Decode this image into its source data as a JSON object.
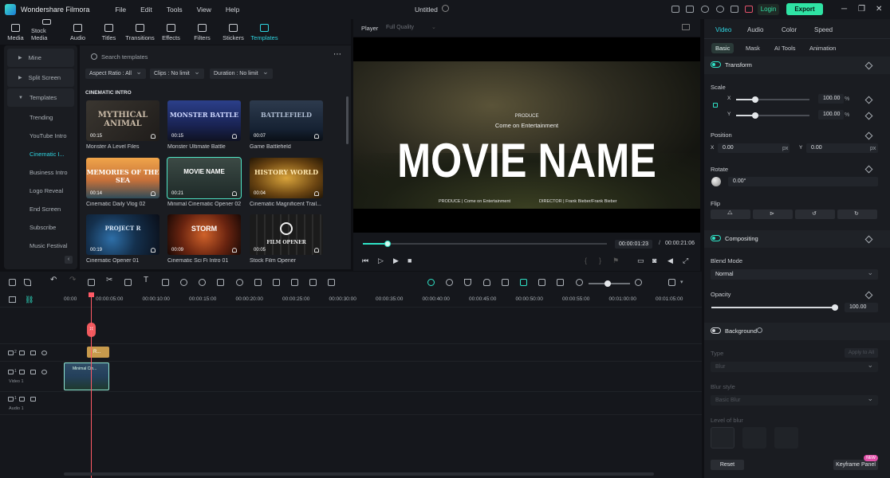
{
  "app": {
    "name": "Wondershare Filmora",
    "doc_title": "Untitled"
  },
  "menu": [
    "File",
    "Edit",
    "Tools",
    "View",
    "Help"
  ],
  "titlebar": {
    "login": "Login",
    "export": "Export"
  },
  "toolbar": [
    {
      "label": "Media",
      "icon": "media-icon"
    },
    {
      "label": "Stock Media",
      "icon": "stock-media-icon"
    },
    {
      "label": "Audio",
      "icon": "music-note-icon"
    },
    {
      "label": "Titles",
      "icon": "text-t-icon"
    },
    {
      "label": "Transitions",
      "icon": "transitions-icon"
    },
    {
      "label": "Effects",
      "icon": "sparkle-icon"
    },
    {
      "label": "Filters",
      "icon": "filters-icon"
    },
    {
      "label": "Stickers",
      "icon": "sticker-icon"
    },
    {
      "label": "Templates",
      "icon": "templates-icon",
      "active": true
    }
  ],
  "categories": {
    "top": [
      "Mine",
      "Split Screen",
      "Templates"
    ],
    "sub": [
      "Trending",
      "YouTube Intro",
      "Cinematic I...",
      "Business Intro",
      "Logo Reveal",
      "End Screen",
      "Subscribe",
      "Music Festival"
    ]
  },
  "templates": {
    "search_placeholder": "Search templates",
    "filters": [
      "Aspect Ratio : All",
      "Clips : No limit",
      "Duration : No limit"
    ],
    "section": "CINEMATIC INTRO",
    "items": [
      {
        "title": "Monster A Level Files",
        "duration": "00:15",
        "thumb_text": "MYTHICAL ANIMAL"
      },
      {
        "title": "Monster Ultimate Battle",
        "duration": "00:15",
        "thumb_text": "MONSTER BATTLE"
      },
      {
        "title": "Game Battlefield",
        "duration": "00:07",
        "thumb_text": "BATTLEFIELD"
      },
      {
        "title": "Cinematic Daily Vlog 02",
        "duration": "00:14",
        "thumb_text": "MEMORIES OF THE SEA"
      },
      {
        "title": "Minimal Cinematic Opener 02",
        "duration": "00:21",
        "thumb_text": "MOVIE NAME"
      },
      {
        "title": "Cinematic Magnificent Trail...",
        "duration": "00:04",
        "thumb_text": "HISTORY WORLD"
      },
      {
        "title": "Cinematic Opener 01",
        "duration": "00:19",
        "thumb_text": "PROJECT R"
      },
      {
        "title": "Cinematic Sci Fi Intro 01",
        "duration": "00:09",
        "thumb_text": "STORM"
      },
      {
        "title": "Stock Film Opener",
        "duration": "00:05",
        "thumb_text": "FILM OPENER"
      }
    ]
  },
  "player": {
    "tab": "Player",
    "quality": "Full Quality",
    "overlay": {
      "produce": "PRODUCE",
      "subtitle": "Come on Entertainment",
      "title": "MOVIE NAME",
      "credit_left": "PRODUCE | Come on Entertainment",
      "credit_right": "DIRECTOR | Frank Bieber/Frank Bieber"
    },
    "current_time": "00:00:01:23",
    "separator": "/",
    "total_time": "00:00:21:06",
    "progress": 0.1
  },
  "inspector": {
    "tabs": [
      "Video",
      "Audio",
      "Color",
      "Speed"
    ],
    "subtabs": [
      "Basic",
      "Mask",
      "AI Tools",
      "Animation"
    ],
    "transform": "Transform",
    "scale_label": "Scale",
    "scale_x": "100.00",
    "scale_y": "100.00",
    "pct": "%",
    "x_axis": "X",
    "y_axis": "Y",
    "position_label": "Position",
    "pos_x": "0.00",
    "pos_y": "0.00",
    "px": "px",
    "rotate_label": "Rotate",
    "rotate_value": "0.00°",
    "flip_label": "Flip",
    "compositing": "Compositing",
    "blend_label": "Blend Mode",
    "blend_value": "Normal",
    "opacity_label": "Opacity",
    "opacity_value": "100.00",
    "background": "Background",
    "type_label": "Type",
    "apply_all": "Apply to All",
    "type_value": "Blur",
    "blur_style_label": "Blur style",
    "blur_style_value": "Basic Blur",
    "level_label": "Level of blur",
    "reset": "Reset",
    "keyframe_panel": "Keyframe Panel",
    "new_badge": "NEW"
  },
  "timeline": {
    "ticks": [
      "00:00",
      "00:00:05:00",
      "00:00:10:00",
      "00:00:15:00",
      "00:00:20:00",
      "00:00:25:00",
      "00:00:30:00",
      "00:00:35:00",
      "00:00:40:00",
      "00:00:45:00",
      "00:00:50:00",
      "00:00:55:00",
      "00:01:00:00",
      "00:01:05:00"
    ],
    "tracks": {
      "video_num": "2",
      "video1_num": "1",
      "audio1_num": "1",
      "video1": "Video 1",
      "audio1": "Audio 1"
    },
    "title_clip": "R...",
    "video_clip": "Minimal Cin..."
  }
}
